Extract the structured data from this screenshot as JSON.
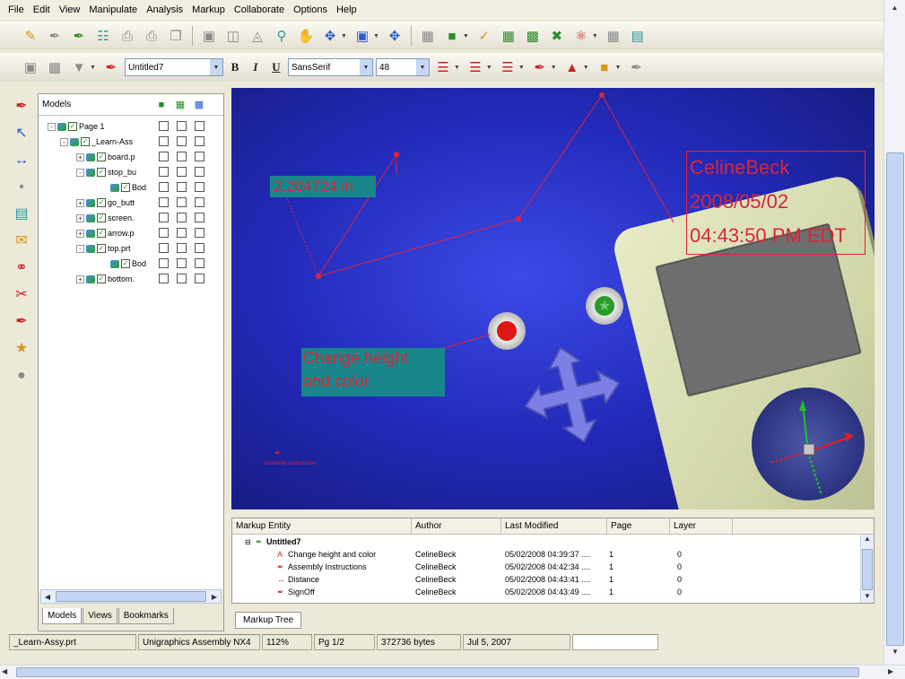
{
  "menu": [
    "File",
    "Edit",
    "View",
    "Manipulate",
    "Analysis",
    "Markup",
    "Collaborate",
    "Options",
    "Help"
  ],
  "toolbar2": {
    "markup_name": "Untitled7",
    "font_name": "SansSerif",
    "font_size": "48",
    "bold_label": "B",
    "italic_label": "I",
    "underline_label": "U"
  },
  "tree": {
    "header": "Models",
    "rows": [
      {
        "label": "Page 1"
      },
      {
        "label": "_Learn-Ass"
      },
      {
        "label": "board.p"
      },
      {
        "label": "stop_bu"
      },
      {
        "label": "Bod"
      },
      {
        "label": "go_butt"
      },
      {
        "label": "screen."
      },
      {
        "label": "arrow.p"
      },
      {
        "label": "top.prt"
      },
      {
        "label": "Bod"
      },
      {
        "label": "bottom."
      }
    ],
    "tabs": [
      "Models",
      "Views",
      "Bookmarks"
    ]
  },
  "viewport": {
    "measure_label": "2.204724 in",
    "markup_label_line1": "Change height",
    "markup_label_line2": "and color",
    "signoff": [
      "CelineBeck",
      "2008/05/02",
      "04:43:50 PM EDT"
    ],
    "small_label": "Assembly Instructions",
    "colors": {
      "annotation": "#d6263a",
      "tag_bg": "#18868a",
      "background": "#2229b8"
    }
  },
  "markup_panel": {
    "columns": [
      "Markup Entity",
      "Author",
      "Last Modified",
      "Page",
      "Layer"
    ],
    "group": "Untitled7",
    "rows": [
      {
        "entity": "Change height and color",
        "author": "CelineBeck",
        "modified": "05/02/2008 04:39:37 ....",
        "page": "1",
        "layer": "0"
      },
      {
        "entity": "Assembly Instructions",
        "author": "CelineBeck",
        "modified": "05/02/2008 04:42:34 ....",
        "page": "1",
        "layer": "0"
      },
      {
        "entity": "Distance",
        "author": "CelineBeck",
        "modified": "05/02/2008 04:43:41 ....",
        "page": "1",
        "layer": "0"
      },
      {
        "entity": "SignOff",
        "author": "CelineBeck",
        "modified": "05/02/2008 04:43:49 ....",
        "page": "1",
        "layer": "0"
      }
    ],
    "tab": "Markup Tree"
  },
  "status": {
    "file": "_Learn-Assy.prt",
    "type": "Unigraphics Assembly NX4",
    "zoom": "112%",
    "page": "Pg 1/2",
    "size": "372736 bytes",
    "date": "Jul 5, 2007"
  }
}
